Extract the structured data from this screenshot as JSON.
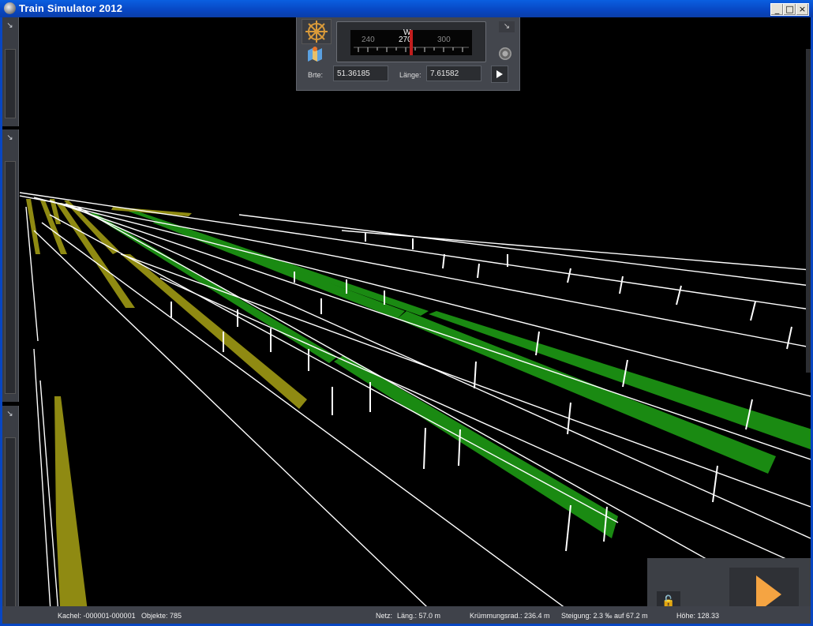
{
  "window": {
    "title": "Train Simulator 2012",
    "controls": {
      "minimize": "_",
      "maximize": "□",
      "close": "×"
    }
  },
  "compass": {
    "ticks": [
      "240",
      "270",
      "300"
    ],
    "cardinal": "W",
    "lat_label": "Brte:",
    "lat_value": "51.36185",
    "lon_label": "Länge:",
    "lon_value": "7.61582"
  },
  "statusbar": {
    "tile": "Kachel: -000001-000001",
    "objects": "Objekte: 785",
    "net": "Netz:",
    "length": "Läng.:   57.0 m",
    "curvature": "Krümmungsrad.: 236.4 m",
    "gradient": "Steigung:  2.3 ‰ auf 67.2 m",
    "height": "Höhe: 128.33"
  },
  "icons": {
    "app": "train-simulator-icon",
    "rose": "compass-rose-icon",
    "map": "map-icon",
    "pin": "pin-icon",
    "gear": "gear-icon",
    "lock": "unlock-icon",
    "play": "play-icon"
  },
  "colors": {
    "track_selected": "#1a8a12",
    "track_other": "#8f8a12",
    "wire": "#ffffff",
    "play": "#f5a442"
  }
}
